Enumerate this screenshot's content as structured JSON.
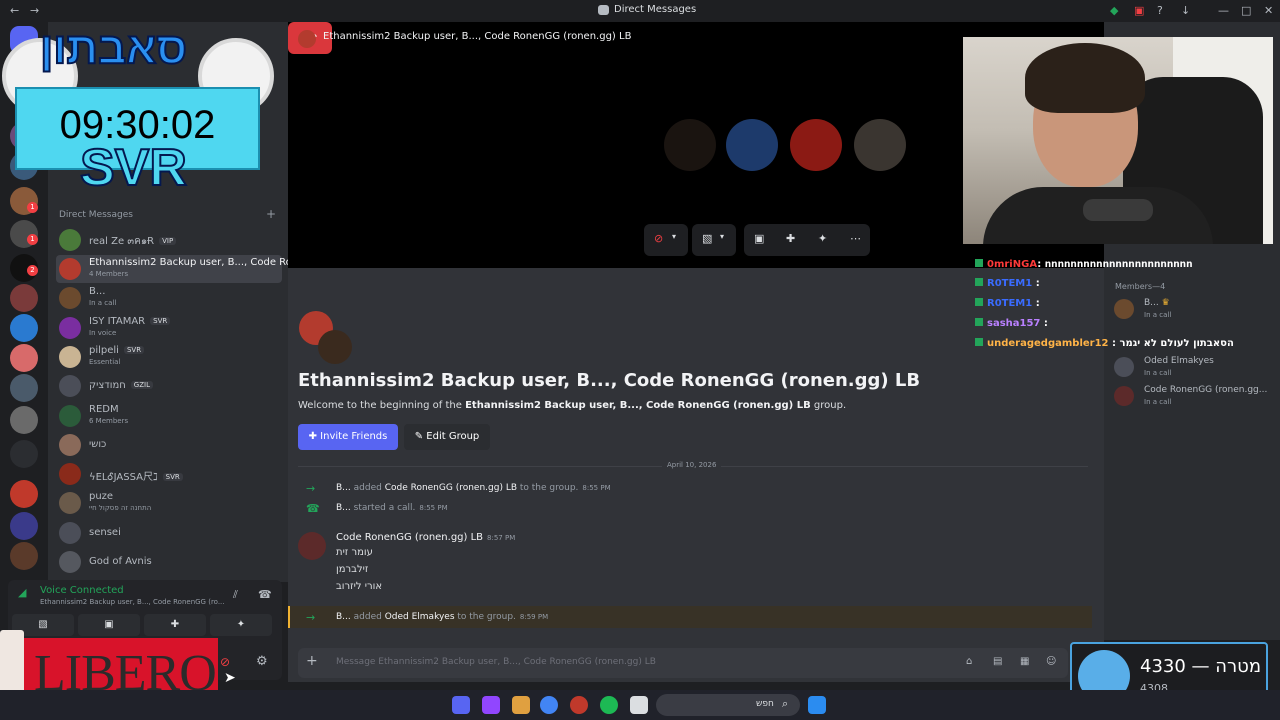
{
  "window": {
    "title": "Direct Messages"
  },
  "overlay": {
    "hebrew_title": "סאבתון",
    "timer": "09:30:02",
    "svr": "SVR",
    "libero": "LIBERO"
  },
  "sidebar": {
    "header": "Direct Messages",
    "add": "+",
    "items": [
      {
        "name": "real Ze ๓ค๑Ɍ",
        "tag": "VIP",
        "sub": "",
        "color": "#4a7a3a"
      },
      {
        "name": "Ethannissim2 Backup user, B..., Code Ro...",
        "tag": "",
        "sub": "4 Members",
        "color": "#b33b2e"
      },
      {
        "name": "B...",
        "tag": "",
        "sub": "In a call",
        "color": "#6b4a2e"
      },
      {
        "name": "ISY ITAMAR",
        "tag": "SVR",
        "sub": "In voice",
        "color": "#7a2ea0"
      },
      {
        "name": "pilpeli",
        "tag": "SVR",
        "sub": "Essential",
        "color": "#c9b493"
      },
      {
        "name": "חמודציק",
        "tag": "GZIL",
        "sub": "",
        "color": "#4b4e58"
      },
      {
        "name": "REDM",
        "tag": "",
        "sub": "6 Members",
        "color": "#2b5b3a"
      },
      {
        "name": "כושי",
        "tag": "",
        "sub": "",
        "color": "#8a6a5a"
      },
      {
        "name": "ϟELᎴJASSA尺ℷ",
        "tag": "SVR",
        "sub": "",
        "color": "#8a2a1a"
      },
      {
        "name": "puze",
        "tag": "",
        "sub": "התחנה זה פסקול חיי",
        "color": "#6a5a4a"
      },
      {
        "name": "sensei",
        "tag": "",
        "sub": "",
        "color": "#4b4e58"
      },
      {
        "name": "God of Avnis",
        "tag": "",
        "sub": "",
        "color": "#55585f"
      }
    ]
  },
  "voice": {
    "title": "Voice Connected",
    "channel": "Ethannissim2 Backup user, B..., Code RonenGG (ro..."
  },
  "call": {
    "title": "Ethannissim2 Backup user, B..., Code RonenGG (ronen.gg) LB"
  },
  "group": {
    "title": "Ethannissim2 Backup user, B..., Code RonenGG (ronen.gg) LB",
    "welcome_prefix": "Welcome to the beginning of the ",
    "welcome_name": "Ethannissim2 Backup user, B..., Code RonenGG (ronen.gg) LB",
    "welcome_suffix": " group.",
    "invite": "Invite Friends",
    "edit": "Edit Group"
  },
  "chat": {
    "date": "April 10, 2026",
    "sys1": {
      "actor": "B...",
      "verb": " added ",
      "target": "Code RonenGG (ronen.gg) LB",
      "rest": " to the group.",
      "time": "8:55 PM"
    },
    "sys2": {
      "actor": "B...",
      "verb": " started a call.",
      "time": "8:55 PM"
    },
    "message": {
      "author": "Code RonenGG (ronen.gg) LB",
      "time": "8:57 PM",
      "lines": [
        "עומר זית",
        "זילברמן",
        "אורי ליזרוב"
      ]
    },
    "sys3": {
      "actor": "B...",
      "verb": " added ",
      "target": "Oded Elmakyes",
      "rest": " to the group.",
      "time": "8:59 PM"
    },
    "composer_placeholder": "Message Ethannissim2 Backup user, B..., Code RonenGG (ronen.gg) LB"
  },
  "members": {
    "header": "Members—4",
    "list": [
      {
        "name": "B...",
        "status": "In a call",
        "color": "#6b4a2e"
      },
      {
        "name": "Oded Elmakyes",
        "status": "In a call",
        "color": "#4b4e58"
      },
      {
        "name": "Code RonenGG (ronen.gg...",
        "status": "In a call",
        "color": "#5c2a2a"
      }
    ]
  },
  "twitch_chat": [
    {
      "user": "0mriNGA",
      "color": "#ff3a3a",
      "msg": ": ոոոոոոոոոոոոոոոոոոոոոոո"
    },
    {
      "user": "R0TEM1",
      "color": "#3a6cff",
      "msg": " :"
    },
    {
      "user": "R0TEM1",
      "color": "#3a6cff",
      "msg": " :"
    },
    {
      "user": "sasha157",
      "color": "#b980ff",
      "msg": " :"
    },
    {
      "user": "underagedgambler12",
      "color": "#ffb347",
      "msg": " : הסאבתון לעולם לא יגמר"
    }
  ],
  "goal": {
    "label": "4330 — מטרה",
    "current": "4308"
  },
  "taskbar": {
    "search": "חפש"
  }
}
